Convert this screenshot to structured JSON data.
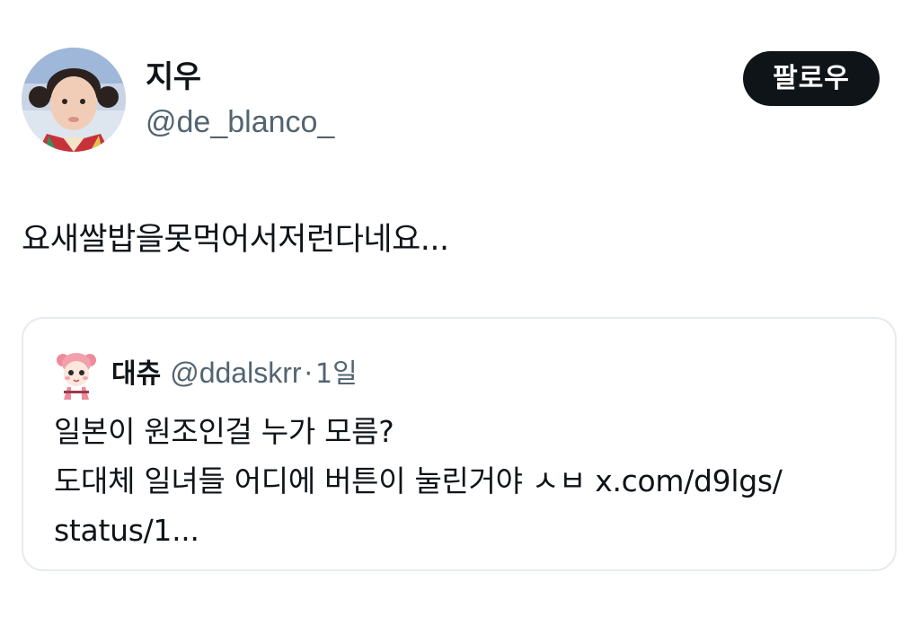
{
  "tweet": {
    "author": {
      "display_name": "지우",
      "handle": "@de_blanco_"
    },
    "follow_label": "팔로우",
    "text": "요새쌀밥을못먹어서저런다네요..."
  },
  "quoted_tweet": {
    "author": {
      "display_name": "대츄",
      "handle": "@ddalskrr"
    },
    "separator": "·",
    "time": "1일",
    "lines": [
      "일본이 원조인걸 누가 모름?",
      "도대체 일녀들 어디에 버튼이 눌린거야 ㅅㅂ x.com/d9lgs/",
      "status/1..."
    ]
  },
  "colors": {
    "text_primary": "#0f1419",
    "text_secondary": "#536471",
    "button_background": "#0f1419",
    "card_border": "#e7ebef"
  }
}
